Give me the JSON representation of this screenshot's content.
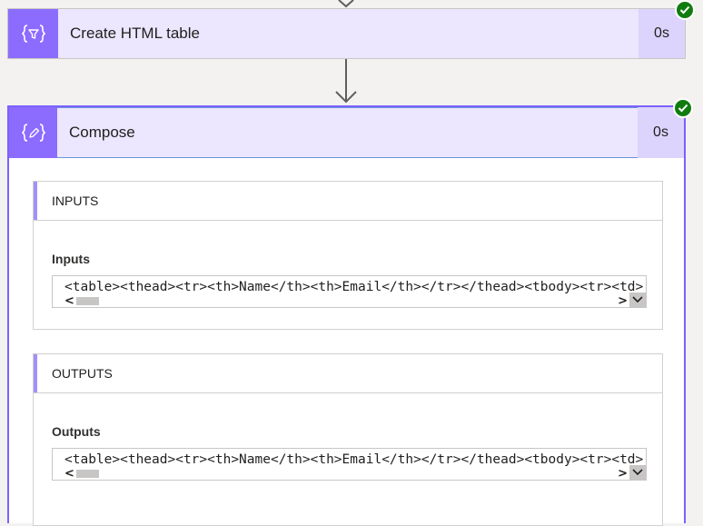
{
  "steps": [
    {
      "title": "Create HTML table",
      "duration": "0s",
      "icon": "filter-braces-icon",
      "status": "succeeded"
    },
    {
      "title": "Compose",
      "duration": "0s",
      "icon": "pencil-braces-icon",
      "status": "succeeded",
      "sections": [
        {
          "header": "INPUTS",
          "field_label": "Inputs",
          "value": "<table><thead><tr><th>Name</th><th>Email</th></tr></thead><tbody><tr><td>"
        },
        {
          "header": "OUTPUTS",
          "field_label": "Outputs",
          "value": "<table><thead><tr><th>Name</th><th>Email</th></tr></thead><tbody><tr><td>"
        }
      ]
    }
  ],
  "colors": {
    "accent": "#8c6cff",
    "header_bg": "#ece6fe",
    "duration_bg": "#ddd4fd",
    "success": "#107c10",
    "selected_border": "#7b61ff",
    "canvas_bg": "#f3f2f1"
  }
}
